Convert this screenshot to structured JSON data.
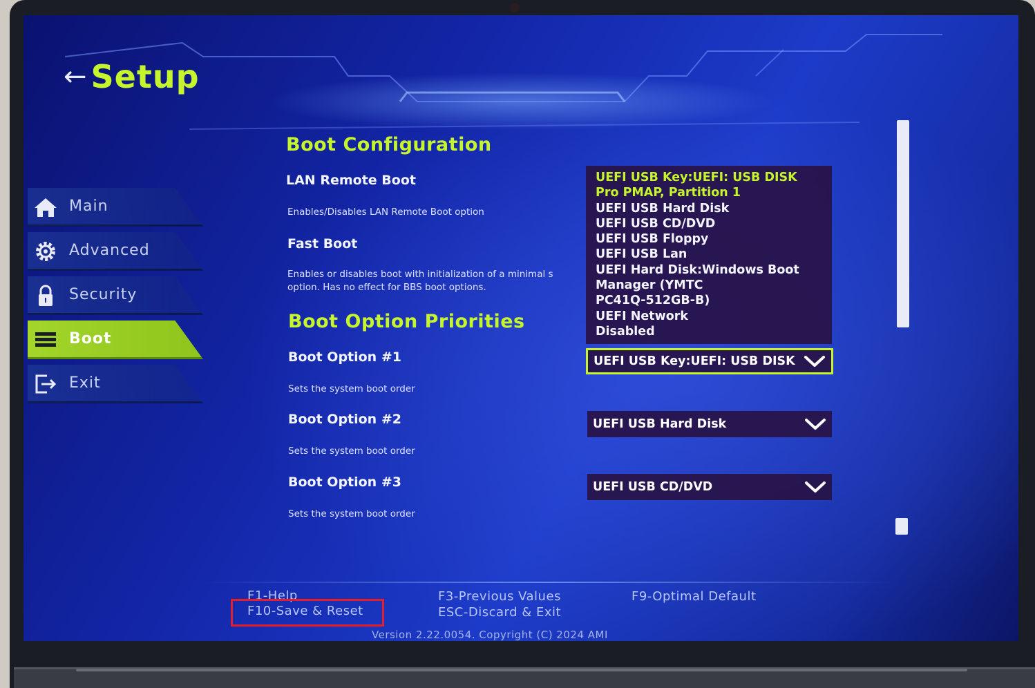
{
  "header": {
    "back_icon": "arrow-left-icon",
    "title": "Setup"
  },
  "sidebar": {
    "items": [
      {
        "label": "Main",
        "icon": "home-icon",
        "active": false
      },
      {
        "label": "Advanced",
        "icon": "gear-icon",
        "active": false
      },
      {
        "label": "Security",
        "icon": "lock-icon",
        "active": false
      },
      {
        "label": "Boot",
        "icon": "list-icon",
        "active": true
      },
      {
        "label": "Exit",
        "icon": "exit-icon",
        "active": false
      }
    ]
  },
  "main": {
    "boot_configuration": {
      "title": "Boot Configuration",
      "lan_remote_boot": {
        "label": "LAN Remote Boot",
        "help": "Enables/Disables LAN Remote Boot option"
      },
      "fast_boot": {
        "label": "Fast Boot",
        "help": "Enables or disables boot with initialization of a minimal s",
        "help_line2": "option. Has no effect for BBS boot options."
      }
    },
    "boot_option_priorities": {
      "title": "Boot Option Priorities",
      "options": [
        {
          "label": "Boot Option #1",
          "help": "Sets the system boot order",
          "value": "UEFI USB Key:UEFI:  USB DISK"
        },
        {
          "label": "Boot Option #2",
          "help": "Sets the system boot order",
          "value": "UEFI USB Hard Disk"
        },
        {
          "label": "Boot Option #3",
          "help": "Sets the system boot order",
          "value": "UEFI USB CD/DVD"
        }
      ]
    },
    "dropdown_list": {
      "options": [
        "UEFI USB Key:UEFI:  USB DISK",
        "Pro PMAP, Partition 1",
        "UEFI USB Hard Disk",
        "UEFI USB CD/DVD",
        "UEFI USB Floppy",
        "UEFI USB Lan",
        "UEFI Hard Disk:Windows Boot",
        "Manager (YMTC",
        "PC41Q-512GB-B)",
        "UEFI Network",
        "Disabled"
      ]
    }
  },
  "footer": {
    "f1": "F1-Help",
    "f10": "F10-Save & Reset",
    "f3": "F3-Previous Values",
    "esc": "ESC-Discard & Exit",
    "f9": "F9-Optimal Default",
    "version": "Version 2.22.0054. Copyright (C) 2024 AMI"
  },
  "colors": {
    "accent": "#c6f52c",
    "active_nav": "#a3d52a",
    "background": "#1326a8",
    "dropdown_bg": "#28124a",
    "highlight_box": "#e51f2a"
  }
}
